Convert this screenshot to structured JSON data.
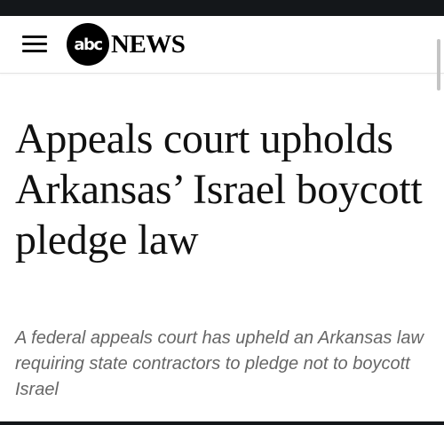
{
  "header": {
    "logo_mark": "abc",
    "logo_word": "NEWS"
  },
  "article": {
    "headline": "Appeals court upholds Arkansas’ Israel boycott pledge law",
    "subheadline": "A federal appeals court has upheld an Arkansas law requiring state contractors to pledge not to boycott Israel"
  },
  "icons": {
    "menu": "hamburger-menu-icon"
  },
  "colors": {
    "status_bar": "#14171a",
    "logo_background": "#000000",
    "headline_text": "#111111",
    "subheadline_text": "#666666"
  }
}
